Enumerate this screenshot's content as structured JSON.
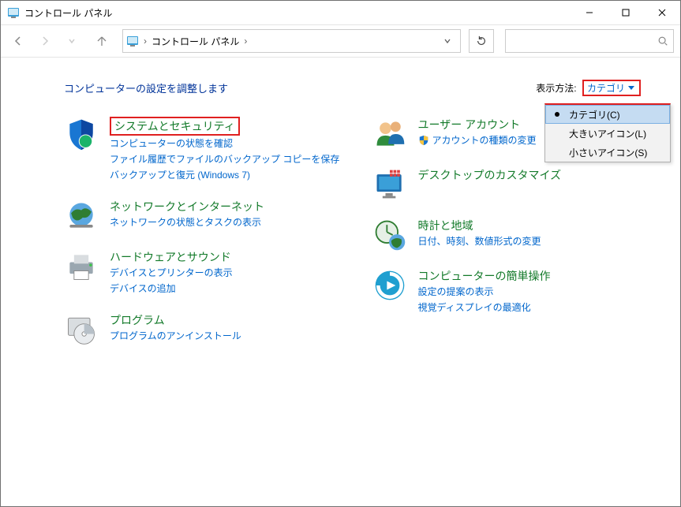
{
  "titlebar": {
    "title": "コントロール パネル"
  },
  "breadcrumb": {
    "root": "コントロール パネル"
  },
  "heading": "コンピューターの設定を調整します",
  "view": {
    "label": "表示方法:",
    "current": "カテゴリ",
    "options": [
      "カテゴリ(C)",
      "大きいアイコン(L)",
      "小さいアイコン(S)"
    ]
  },
  "categories": {
    "left": [
      {
        "title": "システムとセキュリティ",
        "links": [
          "コンピューターの状態を確認",
          "ファイル履歴でファイルのバックアップ コピーを保存",
          "バックアップと復元 (Windows 7)"
        ]
      },
      {
        "title": "ネットワークとインターネット",
        "links": [
          "ネットワークの状態とタスクの表示"
        ]
      },
      {
        "title": "ハードウェアとサウンド",
        "links": [
          "デバイスとプリンターの表示",
          "デバイスの追加"
        ]
      },
      {
        "title": "プログラム",
        "links": [
          "プログラムのアンインストール"
        ]
      }
    ],
    "right": [
      {
        "title": "ユーザー アカウント",
        "links": [
          "アカウントの種類の変更"
        ],
        "shielded_link": true
      },
      {
        "title": "デスクトップのカスタマイズ",
        "links": []
      },
      {
        "title": "時計と地域",
        "links": [
          "日付、時刻、数値形式の変更"
        ]
      },
      {
        "title": "コンピューターの簡単操作",
        "links": [
          "設定の提案の表示",
          "視覚ディスプレイの最適化"
        ]
      }
    ]
  }
}
